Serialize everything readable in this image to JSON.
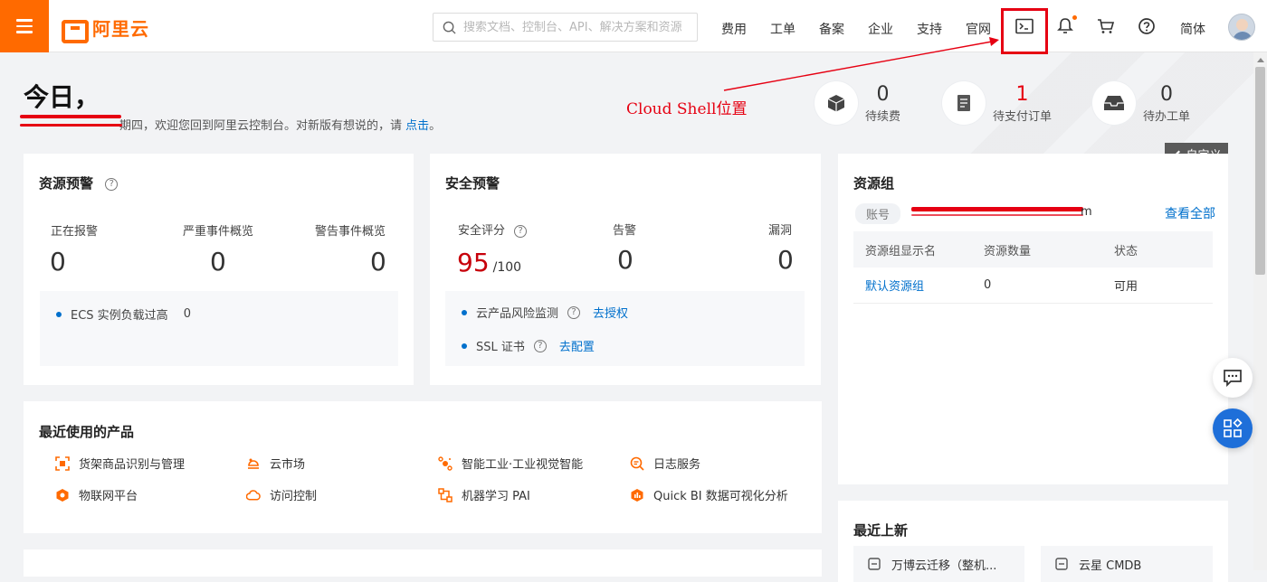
{
  "header": {
    "logo_text": "阿里云",
    "search_placeholder": "搜索文档、控制台、API、解决方案和资源",
    "nav": [
      "费用",
      "工单",
      "备案",
      "企业",
      "支持",
      "官网"
    ],
    "lang": "简体",
    "icons": [
      "menu-icon",
      "search-icon",
      "terminal-icon",
      "bell-icon",
      "cart-icon",
      "help-icon",
      "avatar"
    ]
  },
  "welcome": {
    "title": "今日，",
    "subtitle_visible": "期四，欢迎您回到阿里云控制台。对新版有想说的，请",
    "subtitle_link": "点击",
    "subtitle_end": "。"
  },
  "annotation": "Cloud Shell位置",
  "stats": [
    {
      "value": "0",
      "label": "待续费",
      "icon": "box-icon"
    },
    {
      "value": "1",
      "label": "待支付订单",
      "icon": "order-icon"
    },
    {
      "value": "0",
      "label": "待办工单",
      "icon": "inbox-icon"
    }
  ],
  "customize_label": "自定义",
  "resource_alert": {
    "title": "资源预警",
    "metrics": [
      {
        "label": "正在报警",
        "value": "0"
      },
      {
        "label": "严重事件概览",
        "value": "0"
      },
      {
        "label": "警告事件概览",
        "value": "0"
      }
    ],
    "items": [
      {
        "label": "ECS 实例负载过高",
        "value": "0"
      }
    ]
  },
  "security_alert": {
    "title": "安全预警",
    "score_label": "安全评分",
    "score": "95",
    "score_max": "/100",
    "alarm_label": "告警",
    "alarm_value": "0",
    "vuln_label": "漏洞",
    "vuln_value": "0",
    "items": [
      {
        "label": "云产品风险监测",
        "link": "去授权"
      },
      {
        "label": "SSL 证书",
        "link": "去配置"
      }
    ]
  },
  "resource_group": {
    "title": "资源组",
    "account_label": "账号",
    "account_visible_suffix": "m",
    "view_all": "查看全部",
    "headers": [
      "资源组显示名",
      "资源数量",
      "状态"
    ],
    "rows": [
      {
        "name": "默认资源组",
        "count": "0",
        "status": "可用"
      }
    ]
  },
  "recent_products": {
    "title": "最近使用的产品",
    "items": [
      {
        "label": "货架商品识别与管理",
        "icon": "scan-icon"
      },
      {
        "label": "云市场",
        "icon": "market-icon"
      },
      {
        "label": "智能工业·工业视觉智能",
        "icon": "industry-icon"
      },
      {
        "label": "日志服务",
        "icon": "log-icon"
      },
      {
        "label": "物联网平台",
        "icon": "iot-icon"
      },
      {
        "label": "访问控制",
        "icon": "cloud-access-icon"
      },
      {
        "label": "机器学习 PAI",
        "icon": "ml-icon"
      },
      {
        "label": "Quick BI 数据可视化分析",
        "icon": "bi-icon"
      }
    ]
  },
  "recent_launches": {
    "title": "最近上新",
    "items": [
      "万博云迁移（整机...",
      "云星 CMDB"
    ]
  },
  "colors": {
    "accent": "#ff6a00",
    "link": "#0070cc",
    "score": "#c7000b",
    "annotation": "#e60012"
  }
}
